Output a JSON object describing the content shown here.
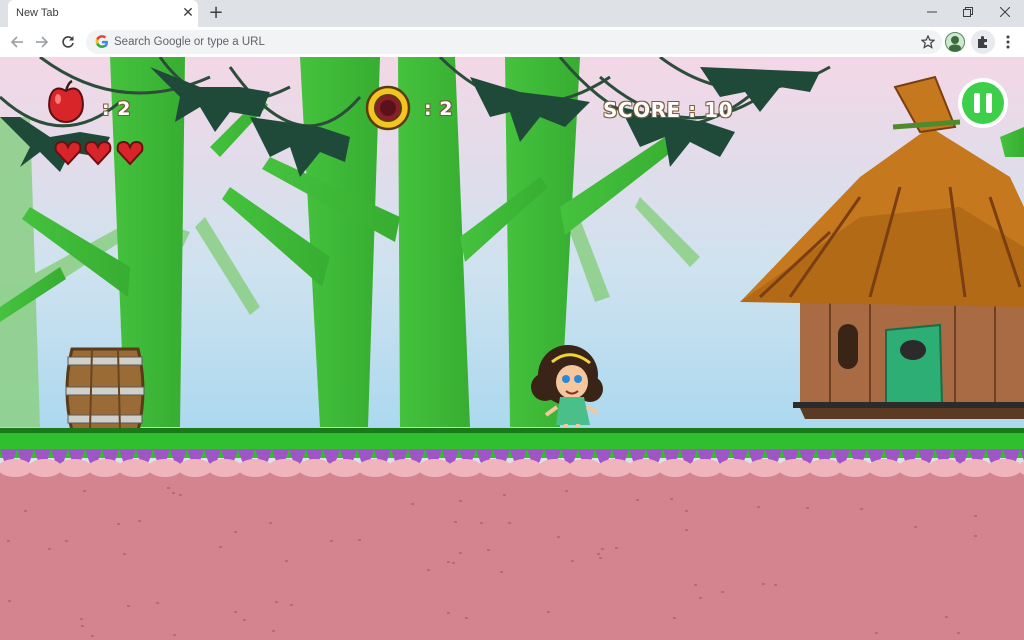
{
  "browser": {
    "tab_title": "New Tab",
    "tab_close_icon": "close-icon",
    "new_tab_icon": "plus-icon",
    "omnibox_placeholder": "Search Google or type a URL"
  },
  "hud": {
    "apples_label": ": 2",
    "coins_label": ": 2",
    "score_label": "SCORE : 10",
    "lives": 3
  },
  "colors": {
    "grass": "#2fbf2f",
    "ground": "#d4848f",
    "sky_top": "#f4d7e6",
    "sky_bottom": "#a9d8ef",
    "pause": "#3ecf4a"
  }
}
